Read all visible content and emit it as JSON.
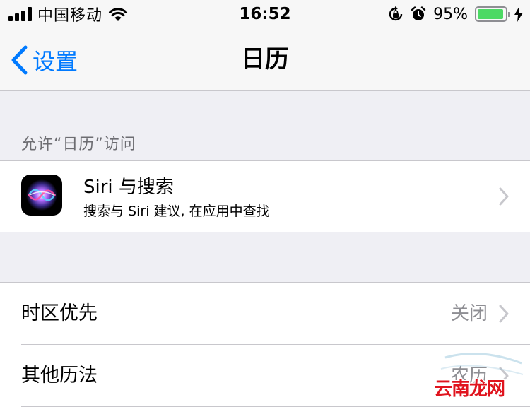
{
  "status_bar": {
    "carrier": "中国移动",
    "time": "16:52",
    "battery_percent": "95%",
    "battery_level": 0.95,
    "icons": [
      "signal-icon",
      "wifi-icon",
      "orientation-lock-icon",
      "alarm-icon",
      "battery-icon",
      "charging-bolt-icon"
    ]
  },
  "nav": {
    "back_label": "设置",
    "title": "日历"
  },
  "section_allow": {
    "header": "允许“日历”访问"
  },
  "siri_cell": {
    "title": "Siri 与搜索",
    "subtitle": "搜索与 Siri 建议, 在应用中查找",
    "icon": "siri-icon"
  },
  "settings": [
    {
      "label": "时区优先",
      "value": "关闭"
    },
    {
      "label": "其他历法",
      "value": "农历"
    }
  ],
  "watermark": {
    "text": "云南龙网"
  },
  "colors": {
    "accent": "#007aff",
    "battery": "#4cd964",
    "background": "#efeff4",
    "secondary_text": "#8e8e93"
  }
}
